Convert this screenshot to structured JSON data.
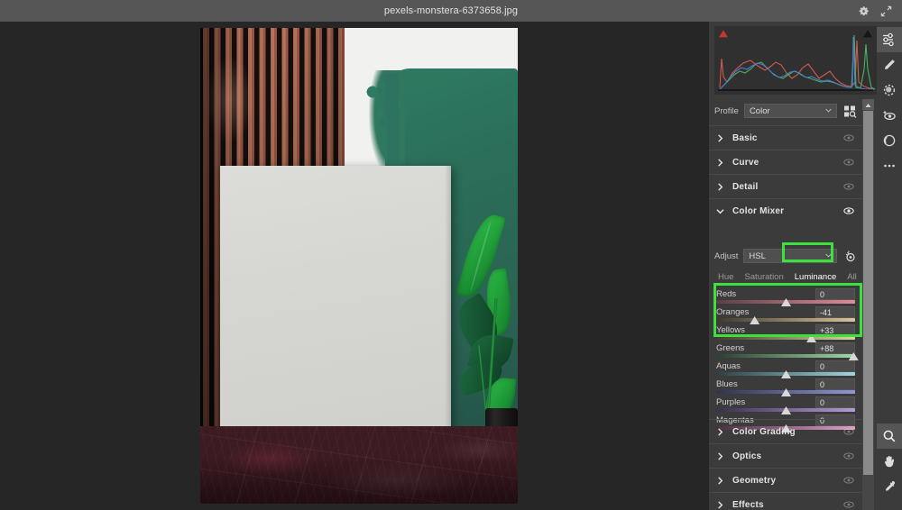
{
  "titlebar": {
    "filename": "pexels-monstera-6373658.jpg",
    "settings_icon": "gear-icon",
    "fullscreen_icon": "expand-arrows-icon"
  },
  "histogram": {
    "shadow_clip_label": "shadow-clipping-indicator",
    "highlight_clip_label": "highlight-clipping-indicator"
  },
  "profile": {
    "label": "Profile",
    "value": "Color",
    "browse_icon": "profile-browser-grid-icon"
  },
  "sections": [
    {
      "name": "Basic",
      "expanded": false
    },
    {
      "name": "Curve",
      "expanded": false
    },
    {
      "name": "Detail",
      "expanded": false
    },
    {
      "name": "Color Mixer",
      "expanded": true
    },
    {
      "name": "Color Grading",
      "expanded": false
    },
    {
      "name": "Optics",
      "expanded": false
    },
    {
      "name": "Geometry",
      "expanded": false
    },
    {
      "name": "Effects",
      "expanded": false
    }
  ],
  "color_mixer": {
    "adjust_label": "Adjust",
    "adjust_value": "HSL",
    "target_tool_icon": "targeted-adjustment-icon",
    "tabs": [
      {
        "label": "Hue",
        "active": false
      },
      {
        "label": "Saturation",
        "active": false
      },
      {
        "label": "Luminance",
        "active": true
      },
      {
        "label": "All",
        "active": false
      }
    ],
    "sliders": [
      {
        "name": "Reds",
        "value": "0",
        "pos": 50,
        "c1": "#5a4045",
        "c2": "#e08b98"
      },
      {
        "name": "Oranges",
        "value": "-41",
        "pos": 29.5,
        "c1": "#40382c",
        "c2": "#d9c49a"
      },
      {
        "name": "Yellows",
        "value": "+33",
        "pos": 66.5,
        "c1": "#3d3e2c",
        "c2": "#d7d69b"
      },
      {
        "name": "Greens",
        "value": "+88",
        "pos": 94,
        "c1": "#2c3f30",
        "c2": "#9fd9a8"
      },
      {
        "name": "Aquas",
        "value": "0",
        "pos": 50,
        "c1": "#2c4044",
        "c2": "#9ed6dd"
      },
      {
        "name": "Blues",
        "value": "0",
        "pos": 50,
        "c1": "#2f3350",
        "c2": "#8f96d6"
      },
      {
        "name": "Purples",
        "value": "0",
        "pos": 50,
        "c1": "#3a2f4c",
        "c2": "#b79ad6"
      },
      {
        "name": "Magentas",
        "value": "0",
        "pos": 50,
        "c1": "#4a2f44",
        "c2": "#dc9ec6"
      }
    ]
  },
  "annotations": {
    "accent_color": "#3ee03e",
    "boxes": [
      {
        "target": "luminance-tab"
      },
      {
        "target": "oranges-yellows-greens-sliders"
      }
    ]
  },
  "toolbar_top": [
    {
      "icon": "edit-sliders-icon",
      "active": true
    },
    {
      "icon": "healing-brush-icon",
      "active": false
    },
    {
      "icon": "spot-removal-icon",
      "active": false
    },
    {
      "icon": "red-eye-icon",
      "active": false
    },
    {
      "icon": "masking-icon",
      "active": false
    },
    {
      "icon": "more-options-icon",
      "active": false
    }
  ],
  "toolbar_bottom": [
    {
      "icon": "zoom-magnifier-icon",
      "active": true
    },
    {
      "icon": "hand-pan-icon",
      "active": false
    },
    {
      "icon": "eyedropper-icon",
      "active": false
    }
  ],
  "scrollbar": {
    "up_arrow_icon": "scroll-up-arrow-icon"
  }
}
